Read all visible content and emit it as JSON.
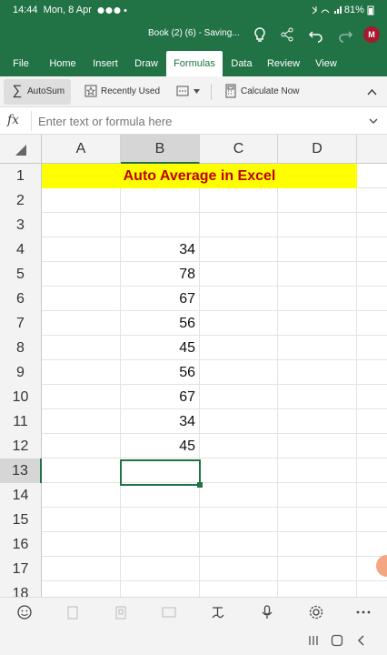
{
  "status_bar": {
    "time": "14:44",
    "date": "Mon, 8 Apr",
    "battery": "81%"
  },
  "title_bar": {
    "doc_title": "Book (2) (6) - Saving...",
    "avatar_initial": "M"
  },
  "tabs": [
    "File",
    "Home",
    "Insert",
    "Draw",
    "Formulas",
    "Data",
    "Review",
    "View"
  ],
  "active_tab": "Formulas",
  "ribbon": {
    "autosum": "AutoSum",
    "recently_used": "Recently Used",
    "calculate_now": "Calculate Now"
  },
  "formula_bar": {
    "fx": "fx",
    "placeholder": "Enter text or formula here",
    "value": ""
  },
  "sheet": {
    "columns": [
      "A",
      "B",
      "C",
      "D"
    ],
    "selected_column": "B",
    "rows": [
      "1",
      "2",
      "3",
      "4",
      "5",
      "6",
      "7",
      "8",
      "9",
      "10",
      "11",
      "12",
      "13",
      "14",
      "15",
      "16",
      "17",
      "18"
    ],
    "selected_row": "13",
    "title": "Auto Average in Excel",
    "b_values": [
      "",
      "",
      "",
      "34",
      "78",
      "67",
      "56",
      "45",
      "56",
      "67",
      "34",
      "45",
      "",
      "",
      "",
      "",
      "",
      ""
    ]
  },
  "colors": {
    "excel_green": "#217346",
    "title_fill": "#ffff00",
    "title_text": "#c00000"
  }
}
